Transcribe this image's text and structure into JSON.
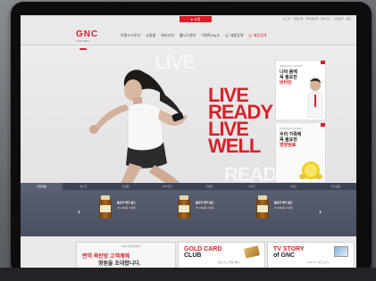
{
  "colors": {
    "brand_red": "#d8202a",
    "bar_dark": "#4a5062"
  },
  "topbar": {
    "tab_label": "● 쇼핑",
    "util_links": [
      "로그인",
      "회원가입",
      "마이페이지",
      "장바구니",
      "고객센터",
      "영문"
    ]
  },
  "header": {
    "logo": "GNC",
    "logo_sub": "LIVE WELL",
    "nav": [
      "브랜드스토리",
      "쇼핑몰",
      "헤리티지",
      "웰니스센터",
      "이벤트&뉴스",
      "Q. 제품검색",
      "Q. 매장검색"
    ]
  },
  "hero": {
    "ghost_word_1": "LIVE",
    "ghost_word_2": "READY",
    "slogan": [
      "LIVE",
      "READY",
      "LIVE",
      "WELL"
    ]
  },
  "side_banners": [
    {
      "small": "PRODUCT EVENT",
      "line1": "나의 몸에",
      "line2": "꼭 필요한",
      "highlight": "비타민"
    },
    {
      "small": "PRODUCT EVENT",
      "line1": "우리 가족에",
      "line2": "꼭 필요한",
      "highlight": "영양원료"
    }
  ],
  "product_tabs": [
    "추천제품",
    "베스트",
    "신제품",
    "MD추천",
    "이벤트",
    "기획전",
    "브랜드",
    "할인상품"
  ],
  "products": [
    {
      "name": "울트라 메가 골드",
      "price": "72,000원 / 60정"
    },
    {
      "name": "울트라 메가 골드",
      "price": "72,000원 / 60정"
    },
    {
      "name": "울트라 메가 골드",
      "price": "72,000원 / 60정"
    }
  ],
  "nav_arrows": {
    "prev": "‹",
    "next": "›"
  },
  "promos": {
    "promo1_tiny": "GNC 건강이야기",
    "promo1_line1": "면역 육탄방 고객께에",
    "promo1_line2": "영원을 초대합니다.",
    "promo2_title_1": "GOLD CARD",
    "promo2_title_2": "CLUB",
    "promo2_desc": "골드카드 회원 혜택",
    "promo3_title_1": "TV STORY",
    "promo3_title_2": "of GNC",
    "promo3_desc": "GNC TV 광고 보기"
  }
}
